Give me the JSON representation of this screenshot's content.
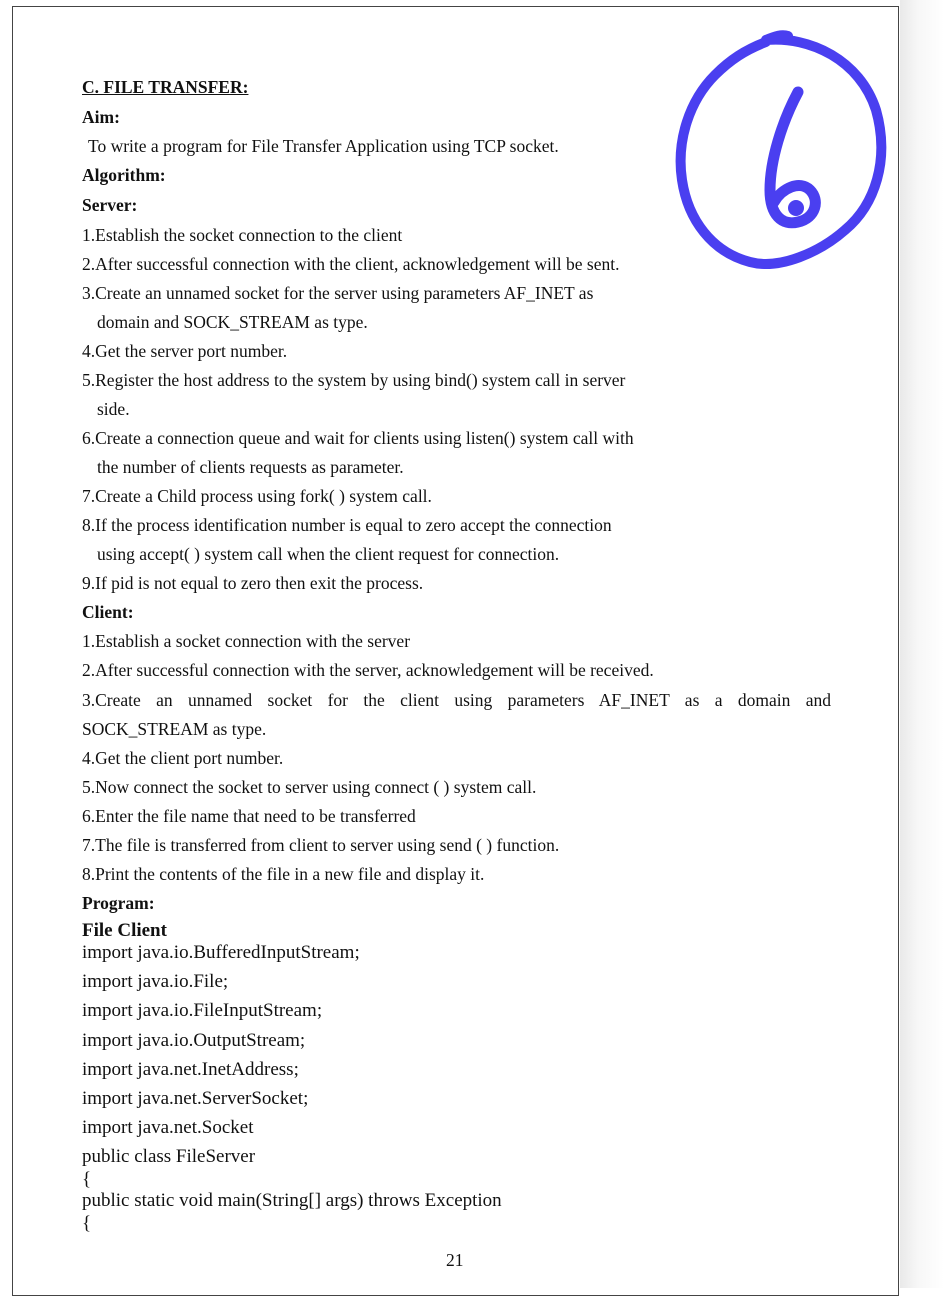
{
  "heading": "C. FILE TRANSFER:",
  "aim_label": "Aim:",
  "aim_text": "To write a program for File Transfer Application using TCP socket.",
  "algorithm_label": "Algorithm:",
  "server_label": "Server:",
  "server_steps": [
    "1.Establish the socket connection to the client",
    "2.After successful connection with the client, acknowledgement will be sent.",
    "3.Create an unnamed socket for the server using parameters AF_INET as",
    "domain and SOCK_STREAM as type.",
    "4.Get the server port number.",
    "5.Register the host address to the system by using bind() system call in server",
    "side.",
    "6.Create a connection queue and wait for clients using listen() system call with",
    "the number of clients requests as parameter.",
    "7.Create a Child process using fork( ) system call.",
    "8.If the process identification number is equal to zero accept the connection",
    "using accept( ) system call when the client request for connection.",
    "9.If pid is not equal to zero then exit the process."
  ],
  "client_label": "Client:",
  "client_steps": [
    "1.Establish a socket connection with the server",
    "2.After successful connection with the server, acknowledgement will be received.",
    "3.Create an unnamed socket for the client using parameters AF_INET as a domain and",
    "SOCK_STREAM as type.",
    "4.Get the client port number.",
    "5.Now connect the socket to server using connect ( ) system call.",
    "6.Enter the file name that need to be transferred",
    "7.The file is transferred from client to server using send ( ) function.",
    "8.Print the contents of the file in a new file and display it."
  ],
  "program_label": "Program:",
  "file_client_label": "File Client",
  "code_lines": [
    "import java.io.BufferedInputStream;",
    "import java.io.File;",
    "import java.io.FileInputStream;",
    "import java.io.OutputStream;",
    "import java.net.InetAddress;",
    "import java.net.ServerSocket;",
    "import java.net.Socket",
    "public class FileServer",
    "{",
    "public static void main(String[] args) throws Exception",
    "{"
  ],
  "page_number": "21",
  "annotation_mark_name": "handwritten-6-circled",
  "annotation_color": "#4a3ff0"
}
